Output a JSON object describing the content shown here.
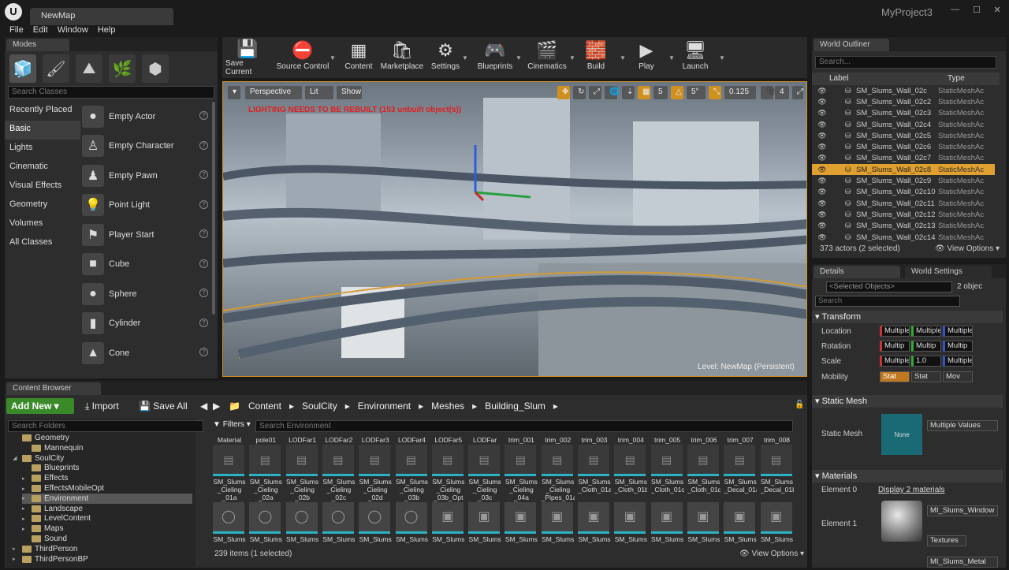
{
  "window": {
    "logo": "U",
    "map_tab": "NewMap",
    "project": "MyProject3",
    "min": "—",
    "max": "☐",
    "close": "✕"
  },
  "menu": [
    "File",
    "Edit",
    "Window",
    "Help"
  ],
  "modes": {
    "tab": "Modes",
    "search_placeholder": "Search Classes",
    "categories": [
      "Recently Placed",
      "Basic",
      "Lights",
      "Cinematic",
      "Visual Effects",
      "Geometry",
      "Volumes",
      "All Classes"
    ],
    "classes": [
      "Empty Actor",
      "Empty Character",
      "Empty Pawn",
      "Point Light",
      "Player Start",
      "Cube",
      "Sphere",
      "Cylinder",
      "Cone"
    ]
  },
  "toolbar": [
    "Save Current",
    "Source Control",
    "Content",
    "Marketplace",
    "Settings",
    "Blueprints",
    "Cinematics",
    "Build",
    "Play",
    "Launch"
  ],
  "viewport": {
    "perspective": "Perspective",
    "lit": "Lit",
    "show": "Show",
    "lighting_warning": "LIGHTING NEEDS TO BE REBUILT (153 unbuilt object(s))",
    "grid_snap": "5",
    "rot_snap": "5°",
    "scale_snap": "0.125",
    "cam_speed": "4",
    "level": "Level: NewMap (Persistent)"
  },
  "outliner": {
    "tab": "World Outliner",
    "search_placeholder": "Search...",
    "col_label": "Label",
    "col_type": "Type",
    "rows": [
      {
        "name": "SM_Slums_Wall_02c",
        "type": "StaticMeshAc"
      },
      {
        "name": "SM_Slums_Wall_02c2",
        "type": "StaticMeshAc"
      },
      {
        "name": "SM_Slums_Wall_02c3",
        "type": "StaticMeshAc"
      },
      {
        "name": "SM_Slums_Wall_02c4",
        "type": "StaticMeshAc"
      },
      {
        "name": "SM_Slums_Wall_02c5",
        "type": "StaticMeshAc"
      },
      {
        "name": "SM_Slums_Wall_02c6",
        "type": "StaticMeshAc"
      },
      {
        "name": "SM_Slums_Wall_02c7",
        "type": "StaticMeshAc"
      },
      {
        "name": "SM_Slums_Wall_02c8",
        "type": "StaticMeshAc"
      },
      {
        "name": "SM_Slums_Wall_02c9",
        "type": "StaticMeshAc"
      },
      {
        "name": "SM_Slums_Wall_02c10",
        "type": "StaticMeshAc"
      },
      {
        "name": "SM_Slums_Wall_02c11",
        "type": "StaticMeshAc"
      },
      {
        "name": "SM_Slums_Wall_02c12",
        "type": "StaticMeshAc"
      },
      {
        "name": "SM_Slums_Wall_02c13",
        "type": "StaticMeshAc"
      },
      {
        "name": "SM_Slums_Wall_02c14",
        "type": "StaticMeshAc"
      }
    ],
    "selected_row": "SM_Slums_Wall_02c8",
    "footer": "373 actors (2 selected)",
    "view_options": "View Options"
  },
  "details": {
    "tab": "Details",
    "tab2": "World Settings",
    "selected": "<Selected Objects>",
    "count": "2 objec",
    "search_placeholder": "Search",
    "transform": "Transform",
    "location": "Location",
    "rotation": "Rotation",
    "scale": "Scale",
    "mobility": "Mobility",
    "multiple": "Multiple",
    "multip": "Multip",
    "scale_y": "1.0",
    "mob_stat1": "Stat",
    "mob_stat2": "Stat",
    "mob_mov": "Mov",
    "static_mesh_section": "Static Mesh",
    "static_mesh_label": "Static Mesh",
    "none": "None",
    "multiple_values": "Multiple Values",
    "materials": "Materials",
    "element0": "Element 0",
    "element1": "Element 1",
    "display_materials": "Display 2 materials",
    "mat_name": "MI_Slums_Window",
    "textures": "Textures",
    "mat_name2": "MI_Slums_Metal"
  },
  "content_browser": {
    "tab": "Content Browser",
    "add_new": "Add New",
    "import": "Import",
    "save_all": "Save All",
    "crumbs": [
      "Content",
      "SoulCity",
      "Environment",
      "Meshes",
      "Building_Slum"
    ],
    "folder_search": "Search Folders",
    "filters": "Filters",
    "asset_search": "Search Environment",
    "folders": [
      "Geometry",
      "Mannequin",
      "SoulCity",
      "Blueprints",
      "Effects",
      "EffectsMobileOpt",
      "Environment",
      "Landscape",
      "LevelContent",
      "Maps",
      "Sound",
      "ThirdPerson",
      "ThirdPersonBP"
    ],
    "assets_row1": [
      {
        "top": "Material",
        "name": "SM_Slums _Cieling _01a"
      },
      {
        "top": "pole01",
        "name": "SM_Slums _Cieling _02a"
      },
      {
        "top": "LODFar1",
        "name": "SM_Slums _Cieling _02b"
      },
      {
        "top": "LODFar2",
        "name": "SM_Slums _Cieling _02c"
      },
      {
        "top": "LODFar3",
        "name": "SM_Slums _Cieling _02d"
      },
      {
        "top": "LODFar4",
        "name": "SM_Slums _Cieling _03b"
      },
      {
        "top": "LODFar5",
        "name": "SM_Slums _Cieling _03b_Opt"
      },
      {
        "top": "LODFar",
        "name": "SM_Slums _Cieling _03c"
      },
      {
        "top": "trim_001",
        "name": "SM_Slums _Cieling _04a"
      },
      {
        "top": "trim_002",
        "name": "SM_Slums _Cieling _Pipes_01a"
      },
      {
        "top": "trim_003",
        "name": "SM_Slums _Cloth_01a"
      },
      {
        "top": "trim_004",
        "name": "SM_Slums _Cloth_01b"
      },
      {
        "top": "trim_005",
        "name": "SM_Slums _Cloth_01c"
      },
      {
        "top": "trim_006",
        "name": "SM_Slums _Cloth_01d"
      },
      {
        "top": "trim_007",
        "name": "SM_Slums _Decal_01a"
      },
      {
        "top": "trim_008",
        "name": "SM_Slums _Decal_01b"
      }
    ],
    "row2_label": "SM_Slums",
    "status": "239 items (1 selected)",
    "view_options": "View Options"
  }
}
